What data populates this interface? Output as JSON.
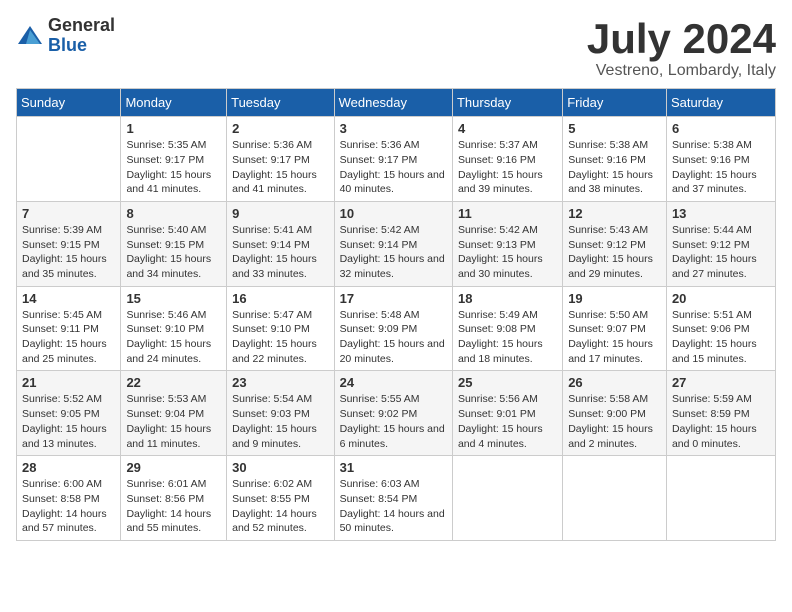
{
  "header": {
    "logo_general": "General",
    "logo_blue": "Blue",
    "main_title": "July 2024",
    "subtitle": "Vestreno, Lombardy, Italy"
  },
  "calendar": {
    "days_of_week": [
      "Sunday",
      "Monday",
      "Tuesday",
      "Wednesday",
      "Thursday",
      "Friday",
      "Saturday"
    ],
    "weeks": [
      [
        {
          "day": "",
          "sunrise": "",
          "sunset": "",
          "daylight": ""
        },
        {
          "day": "1",
          "sunrise": "Sunrise: 5:35 AM",
          "sunset": "Sunset: 9:17 PM",
          "daylight": "Daylight: 15 hours and 41 minutes."
        },
        {
          "day": "2",
          "sunrise": "Sunrise: 5:36 AM",
          "sunset": "Sunset: 9:17 PM",
          "daylight": "Daylight: 15 hours and 41 minutes."
        },
        {
          "day": "3",
          "sunrise": "Sunrise: 5:36 AM",
          "sunset": "Sunset: 9:17 PM",
          "daylight": "Daylight: 15 hours and 40 minutes."
        },
        {
          "day": "4",
          "sunrise": "Sunrise: 5:37 AM",
          "sunset": "Sunset: 9:16 PM",
          "daylight": "Daylight: 15 hours and 39 minutes."
        },
        {
          "day": "5",
          "sunrise": "Sunrise: 5:38 AM",
          "sunset": "Sunset: 9:16 PM",
          "daylight": "Daylight: 15 hours and 38 minutes."
        },
        {
          "day": "6",
          "sunrise": "Sunrise: 5:38 AM",
          "sunset": "Sunset: 9:16 PM",
          "daylight": "Daylight: 15 hours and 37 minutes."
        }
      ],
      [
        {
          "day": "7",
          "sunrise": "Sunrise: 5:39 AM",
          "sunset": "Sunset: 9:15 PM",
          "daylight": "Daylight: 15 hours and 35 minutes."
        },
        {
          "day": "8",
          "sunrise": "Sunrise: 5:40 AM",
          "sunset": "Sunset: 9:15 PM",
          "daylight": "Daylight: 15 hours and 34 minutes."
        },
        {
          "day": "9",
          "sunrise": "Sunrise: 5:41 AM",
          "sunset": "Sunset: 9:14 PM",
          "daylight": "Daylight: 15 hours and 33 minutes."
        },
        {
          "day": "10",
          "sunrise": "Sunrise: 5:42 AM",
          "sunset": "Sunset: 9:14 PM",
          "daylight": "Daylight: 15 hours and 32 minutes."
        },
        {
          "day": "11",
          "sunrise": "Sunrise: 5:42 AM",
          "sunset": "Sunset: 9:13 PM",
          "daylight": "Daylight: 15 hours and 30 minutes."
        },
        {
          "day": "12",
          "sunrise": "Sunrise: 5:43 AM",
          "sunset": "Sunset: 9:12 PM",
          "daylight": "Daylight: 15 hours and 29 minutes."
        },
        {
          "day": "13",
          "sunrise": "Sunrise: 5:44 AM",
          "sunset": "Sunset: 9:12 PM",
          "daylight": "Daylight: 15 hours and 27 minutes."
        }
      ],
      [
        {
          "day": "14",
          "sunrise": "Sunrise: 5:45 AM",
          "sunset": "Sunset: 9:11 PM",
          "daylight": "Daylight: 15 hours and 25 minutes."
        },
        {
          "day": "15",
          "sunrise": "Sunrise: 5:46 AM",
          "sunset": "Sunset: 9:10 PM",
          "daylight": "Daylight: 15 hours and 24 minutes."
        },
        {
          "day": "16",
          "sunrise": "Sunrise: 5:47 AM",
          "sunset": "Sunset: 9:10 PM",
          "daylight": "Daylight: 15 hours and 22 minutes."
        },
        {
          "day": "17",
          "sunrise": "Sunrise: 5:48 AM",
          "sunset": "Sunset: 9:09 PM",
          "daylight": "Daylight: 15 hours and 20 minutes."
        },
        {
          "day": "18",
          "sunrise": "Sunrise: 5:49 AM",
          "sunset": "Sunset: 9:08 PM",
          "daylight": "Daylight: 15 hours and 18 minutes."
        },
        {
          "day": "19",
          "sunrise": "Sunrise: 5:50 AM",
          "sunset": "Sunset: 9:07 PM",
          "daylight": "Daylight: 15 hours and 17 minutes."
        },
        {
          "day": "20",
          "sunrise": "Sunrise: 5:51 AM",
          "sunset": "Sunset: 9:06 PM",
          "daylight": "Daylight: 15 hours and 15 minutes."
        }
      ],
      [
        {
          "day": "21",
          "sunrise": "Sunrise: 5:52 AM",
          "sunset": "Sunset: 9:05 PM",
          "daylight": "Daylight: 15 hours and 13 minutes."
        },
        {
          "day": "22",
          "sunrise": "Sunrise: 5:53 AM",
          "sunset": "Sunset: 9:04 PM",
          "daylight": "Daylight: 15 hours and 11 minutes."
        },
        {
          "day": "23",
          "sunrise": "Sunrise: 5:54 AM",
          "sunset": "Sunset: 9:03 PM",
          "daylight": "Daylight: 15 hours and 9 minutes."
        },
        {
          "day": "24",
          "sunrise": "Sunrise: 5:55 AM",
          "sunset": "Sunset: 9:02 PM",
          "daylight": "Daylight: 15 hours and 6 minutes."
        },
        {
          "day": "25",
          "sunrise": "Sunrise: 5:56 AM",
          "sunset": "Sunset: 9:01 PM",
          "daylight": "Daylight: 15 hours and 4 minutes."
        },
        {
          "day": "26",
          "sunrise": "Sunrise: 5:58 AM",
          "sunset": "Sunset: 9:00 PM",
          "daylight": "Daylight: 15 hours and 2 minutes."
        },
        {
          "day": "27",
          "sunrise": "Sunrise: 5:59 AM",
          "sunset": "Sunset: 8:59 PM",
          "daylight": "Daylight: 15 hours and 0 minutes."
        }
      ],
      [
        {
          "day": "28",
          "sunrise": "Sunrise: 6:00 AM",
          "sunset": "Sunset: 8:58 PM",
          "daylight": "Daylight: 14 hours and 57 minutes."
        },
        {
          "day": "29",
          "sunrise": "Sunrise: 6:01 AM",
          "sunset": "Sunset: 8:56 PM",
          "daylight": "Daylight: 14 hours and 55 minutes."
        },
        {
          "day": "30",
          "sunrise": "Sunrise: 6:02 AM",
          "sunset": "Sunset: 8:55 PM",
          "daylight": "Daylight: 14 hours and 52 minutes."
        },
        {
          "day": "31",
          "sunrise": "Sunrise: 6:03 AM",
          "sunset": "Sunset: 8:54 PM",
          "daylight": "Daylight: 14 hours and 50 minutes."
        },
        {
          "day": "",
          "sunrise": "",
          "sunset": "",
          "daylight": ""
        },
        {
          "day": "",
          "sunrise": "",
          "sunset": "",
          "daylight": ""
        },
        {
          "day": "",
          "sunrise": "",
          "sunset": "",
          "daylight": ""
        }
      ]
    ]
  }
}
